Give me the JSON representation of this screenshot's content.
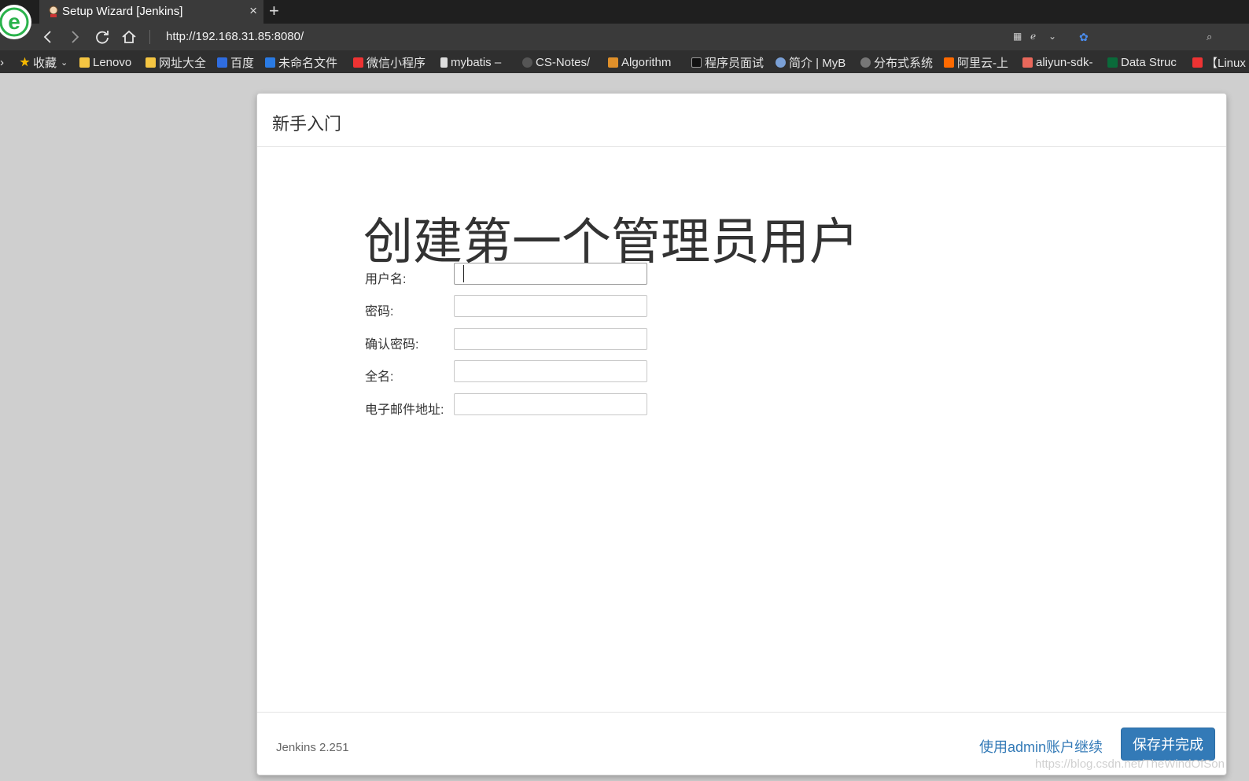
{
  "browser": {
    "tab_title": "Setup Wizard [Jenkins]",
    "tab_close": "×",
    "new_tab": "+",
    "url": "http://192.168.31.85:8080/"
  },
  "bookmarks": [
    {
      "label": "收藏",
      "icon": "star-icon",
      "color": "#f5b800"
    },
    {
      "label": "Lenovo",
      "icon": "folder-icon",
      "color": "#f4c542"
    },
    {
      "label": "网址大全",
      "icon": "folder-icon",
      "color": "#f4c542"
    },
    {
      "label": "百度",
      "icon": "baidu-icon",
      "color": "#2f6de1"
    },
    {
      "label": "未命名文件",
      "icon": "processon-icon",
      "color": "#2a7be4"
    },
    {
      "label": "微信小程序",
      "icon": "csdn-icon",
      "color": "#e33"
    },
    {
      "label": "mybatis –",
      "icon": "page-icon",
      "color": "#ddd"
    },
    {
      "label": "CS-Notes/",
      "icon": "github-icon",
      "color": "#555"
    },
    {
      "label": "Algorithm",
      "icon": "algorithm-icon",
      "color": "#e0902a"
    },
    {
      "label": "程序员面试",
      "icon": "page-icon",
      "color": "#111"
    },
    {
      "label": "简介 | MyB",
      "icon": "bird-icon",
      "color": "#7aa0d6"
    },
    {
      "label": "分布式系统",
      "icon": "globe-icon",
      "color": "#777"
    },
    {
      "label": "阿里云-上",
      "icon": "aliyun-icon",
      "color": "#ff6a00"
    },
    {
      "label": "aliyun-sdk-",
      "icon": "jianshu-icon",
      "color": "#e9685b"
    },
    {
      "label": "Data Struc",
      "icon": "usf-icon",
      "color": "#0a6a3a"
    },
    {
      "label": "【Linux",
      "icon": "csdn-icon",
      "color": "#e33"
    }
  ],
  "dialog": {
    "title": "新手入门",
    "heading": "创建第一个管理员用户",
    "fields": [
      {
        "label": "用户名:",
        "value": ""
      },
      {
        "label": "密码:",
        "value": ""
      },
      {
        "label": "确认密码:",
        "value": ""
      },
      {
        "label": "全名:",
        "value": ""
      },
      {
        "label": "电子邮件地址:",
        "value": ""
      }
    ],
    "version": "Jenkins 2.251",
    "skip_label": "使用admin账户继续",
    "save_label": "保存并完成"
  },
  "watermark": "https://blog.csdn.net/TheWindOfSon",
  "colors": {
    "primary": "#337ab7",
    "link": "#337ab7",
    "browser_bg": "#3a3a3a",
    "page_bg": "#cfcfcf"
  }
}
